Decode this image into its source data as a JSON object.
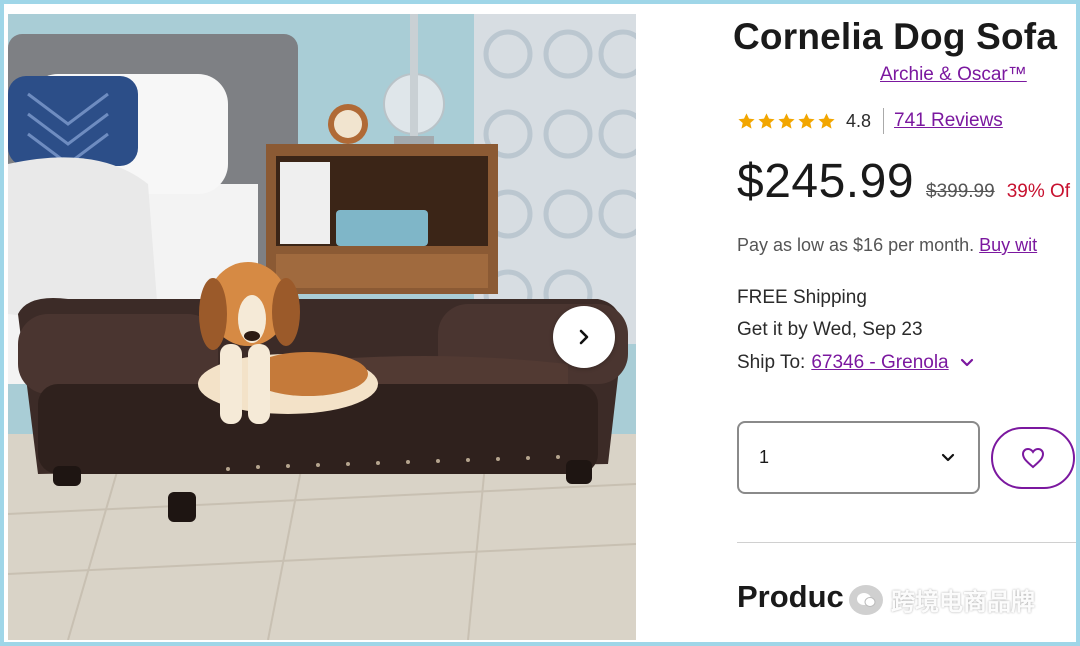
{
  "product": {
    "title": "Cornelia Dog Sofa",
    "brand": "Archie & Oscar™",
    "rating": "4.8",
    "reviews_label": "741 Reviews",
    "price": "$245.99",
    "old_price": "$399.99",
    "discount": "39% Of",
    "pay_text": "Pay as low as $16 per month. ",
    "pay_link": "Buy wit",
    "stars_filled": 5
  },
  "shipping": {
    "free": "FREE Shipping",
    "delivery": "Get it by Wed, Sep 23",
    "ship_to_label": "Ship To:",
    "zip": "67346 - Grenola"
  },
  "quantity": {
    "value": "1"
  },
  "section": {
    "title": "Produc"
  },
  "watermark": {
    "text": "跨境电商品牌"
  },
  "icons": {
    "next": "chevron-right-icon",
    "qty": "chevron-down-icon",
    "fav": "heart-icon",
    "ship": "chevron-down-icon",
    "star": "star-icon"
  },
  "colors": {
    "link": "#7b189f",
    "discount": "#c7112f",
    "star": "#f2a600",
    "background": "#9fd6e8"
  }
}
